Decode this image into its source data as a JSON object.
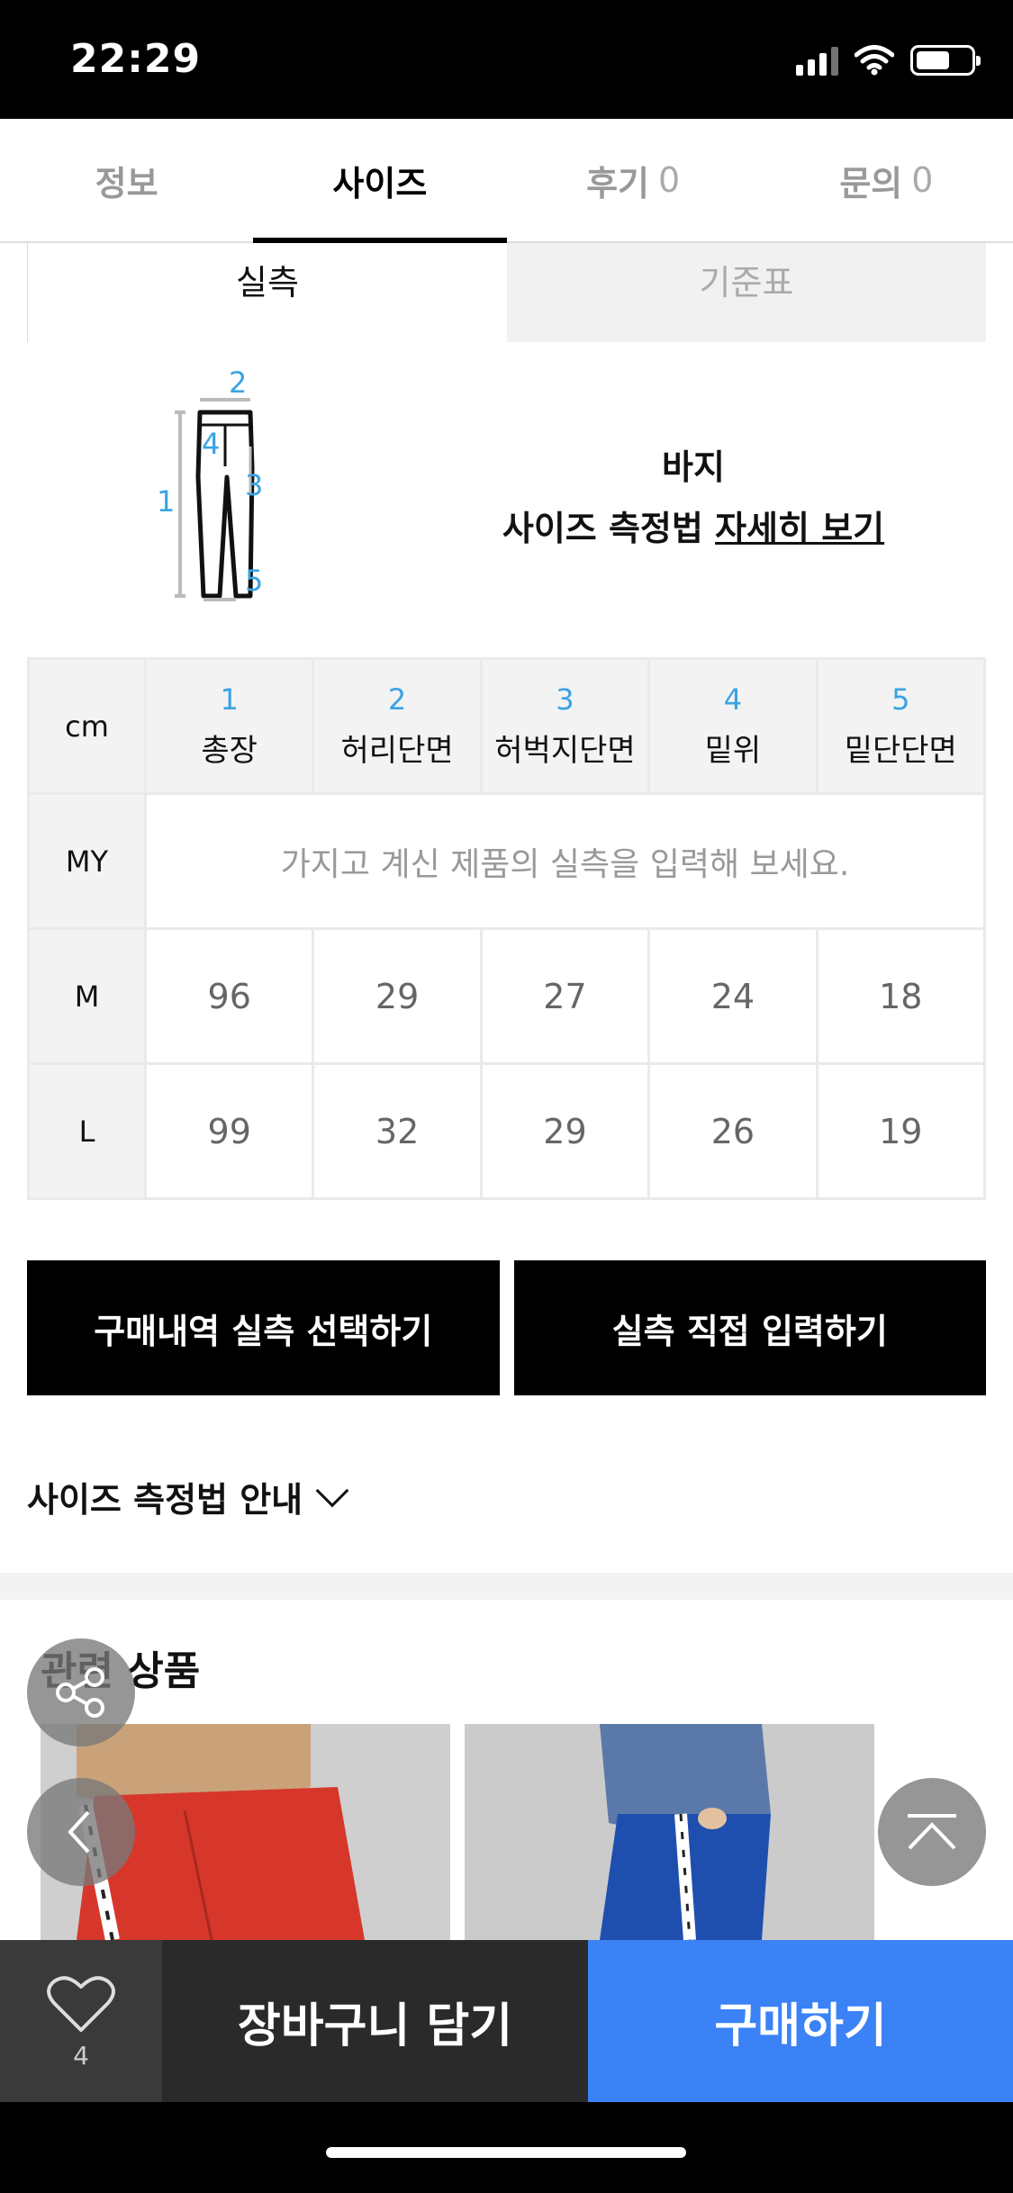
{
  "status_bar": {
    "time": "22:29"
  },
  "main_tabs": [
    {
      "label": "정보",
      "count": ""
    },
    {
      "label": "사이즈",
      "count": "",
      "active": true
    },
    {
      "label": "후기",
      "count": "0"
    },
    {
      "label": "문의",
      "count": "0"
    }
  ],
  "sub_tabs": [
    {
      "label": "실측",
      "active": true
    },
    {
      "label": "기준표",
      "active": false
    }
  ],
  "diagram": {
    "labels": [
      "1",
      "2",
      "3",
      "4",
      "5"
    ],
    "accent_color": "#3aa3e3"
  },
  "guide": {
    "category": "바지",
    "prefix": "사이즈 측정법 ",
    "link": "자세히 보기"
  },
  "size_table": {
    "unit": "cm",
    "columns": [
      {
        "num": "1",
        "name": "총장"
      },
      {
        "num": "2",
        "name": "허리단면"
      },
      {
        "num": "3",
        "name": "허벅지단면"
      },
      {
        "num": "4",
        "name": "밑위"
      },
      {
        "num": "5",
        "name": "밑단단면"
      }
    ],
    "my_row": {
      "label": "MY",
      "hint": "가지고 계신 제품의 실측을 입력해 보세요."
    },
    "rows": [
      {
        "label": "M",
        "values": [
          "96",
          "29",
          "27",
          "24",
          "18"
        ]
      },
      {
        "label": "L",
        "values": [
          "99",
          "32",
          "29",
          "26",
          "19"
        ]
      }
    ]
  },
  "buttons": {
    "purchase_history": "구매내역 실측 선택하기",
    "direct_input": "실측 직접 입력하기"
  },
  "size_guide_toggle": "사이즈 측정법 안내",
  "related": {
    "title": "관련 상품"
  },
  "bottom_bar": {
    "like_count": "4",
    "cart_label": "장바구니 담기",
    "buy_label": "구매하기",
    "buy_color": "#3b82f6"
  }
}
